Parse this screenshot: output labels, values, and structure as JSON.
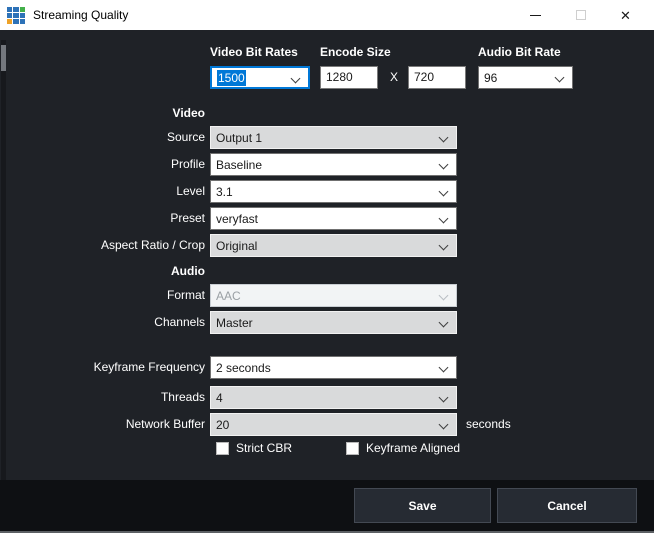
{
  "window": {
    "title": "Streaming Quality",
    "app_icon": {
      "name": "grid-logo-icon",
      "colors": [
        "#2d72b8",
        "#43b04a",
        "#eea228"
      ]
    }
  },
  "top_fields": {
    "video_bit_rates": {
      "label": "Video Bit Rates",
      "value": "1500"
    },
    "encode_size": {
      "label": "Encode Size",
      "width": "1280",
      "separator": "X",
      "height": "720"
    },
    "audio_bit_rate": {
      "label": "Audio Bit Rate",
      "value": "96"
    }
  },
  "sections": {
    "video": "Video",
    "audio": "Audio"
  },
  "fields": {
    "source": {
      "label": "Source",
      "value": "Output 1"
    },
    "profile": {
      "label": "Profile",
      "value": "Baseline"
    },
    "level": {
      "label": "Level",
      "value": "3.1"
    },
    "preset": {
      "label": "Preset",
      "value": "veryfast"
    },
    "aspect": {
      "label": "Aspect Ratio / Crop",
      "value": "Original"
    },
    "format": {
      "label": "Format",
      "value": "AAC",
      "disabled": true
    },
    "channels": {
      "label": "Channels",
      "value": "Master"
    },
    "keyframe": {
      "label": "Keyframe Frequency",
      "value": "2 seconds"
    },
    "threads": {
      "label": "Threads",
      "value": "4"
    },
    "network_buffer": {
      "label": "Network Buffer",
      "value": "20",
      "suffix": "seconds"
    }
  },
  "checkboxes": {
    "strict_cbr": {
      "label": "Strict CBR",
      "checked": false
    },
    "keyframe_aligned": {
      "label": "Keyframe Aligned",
      "checked": false
    }
  },
  "footer": {
    "save": "Save",
    "cancel": "Cancel"
  },
  "colors": {
    "accent": "#0078d7",
    "titlebar_bg": "#ffffff",
    "body_bg": "#1f2227",
    "footer_bg": "#0e1013",
    "button_bg": "#262b33",
    "button_border": "#434953"
  }
}
